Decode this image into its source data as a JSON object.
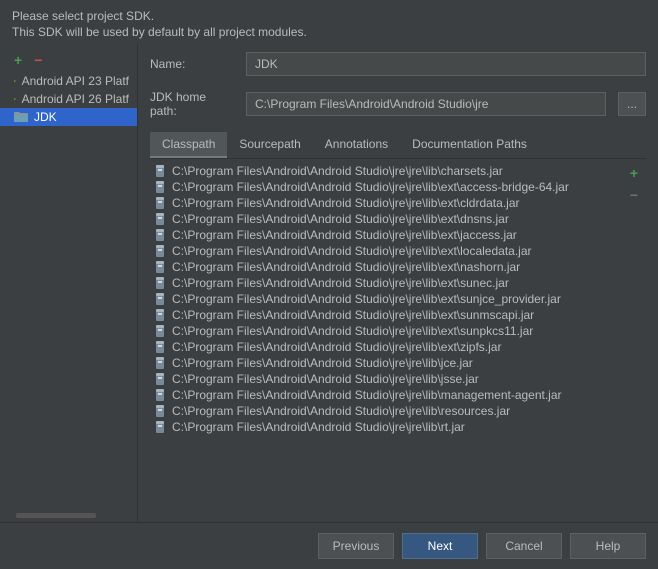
{
  "header": {
    "line1": "Please select project SDK.",
    "line2": "This SDK will be used by default by all project modules."
  },
  "sidebar": {
    "items": [
      {
        "type": "android",
        "label": "Android API 23 Platf"
      },
      {
        "type": "android",
        "label": "Android API 26 Platf"
      },
      {
        "type": "folder",
        "label": "JDK",
        "selected": true
      }
    ]
  },
  "form": {
    "name_label": "Name:",
    "name_value": "JDK",
    "home_label": "JDK home path:",
    "home_value": "C:\\Program Files\\Android\\Android Studio\\jre",
    "browse": "..."
  },
  "tabs": [
    {
      "label": "Classpath",
      "active": true
    },
    {
      "label": "Sourcepath"
    },
    {
      "label": "Annotations"
    },
    {
      "label": "Documentation Paths"
    }
  ],
  "classpath": [
    "C:\\Program Files\\Android\\Android Studio\\jre\\jre\\lib\\charsets.jar",
    "C:\\Program Files\\Android\\Android Studio\\jre\\jre\\lib\\ext\\access-bridge-64.jar",
    "C:\\Program Files\\Android\\Android Studio\\jre\\jre\\lib\\ext\\cldrdata.jar",
    "C:\\Program Files\\Android\\Android Studio\\jre\\jre\\lib\\ext\\dnsns.jar",
    "C:\\Program Files\\Android\\Android Studio\\jre\\jre\\lib\\ext\\jaccess.jar",
    "C:\\Program Files\\Android\\Android Studio\\jre\\jre\\lib\\ext\\localedata.jar",
    "C:\\Program Files\\Android\\Android Studio\\jre\\jre\\lib\\ext\\nashorn.jar",
    "C:\\Program Files\\Android\\Android Studio\\jre\\jre\\lib\\ext\\sunec.jar",
    "C:\\Program Files\\Android\\Android Studio\\jre\\jre\\lib\\ext\\sunjce_provider.jar",
    "C:\\Program Files\\Android\\Android Studio\\jre\\jre\\lib\\ext\\sunmscapi.jar",
    "C:\\Program Files\\Android\\Android Studio\\jre\\jre\\lib\\ext\\sunpkcs11.jar",
    "C:\\Program Files\\Android\\Android Studio\\jre\\jre\\lib\\ext\\zipfs.jar",
    "C:\\Program Files\\Android\\Android Studio\\jre\\jre\\lib\\jce.jar",
    "C:\\Program Files\\Android\\Android Studio\\jre\\jre\\lib\\jsse.jar",
    "C:\\Program Files\\Android\\Android Studio\\jre\\jre\\lib\\management-agent.jar",
    "C:\\Program Files\\Android\\Android Studio\\jre\\jre\\lib\\resources.jar",
    "C:\\Program Files\\Android\\Android Studio\\jre\\jre\\lib\\rt.jar"
  ],
  "footer": {
    "previous": "Previous",
    "next": "Next",
    "cancel": "Cancel",
    "help": "Help"
  }
}
